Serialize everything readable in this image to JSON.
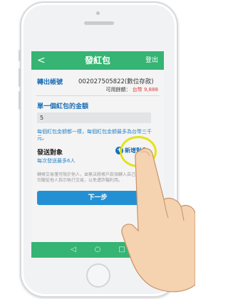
{
  "header": {
    "title": "發紅包",
    "back_icon": "back-arrow-icon",
    "logout_label": "登出"
  },
  "account": {
    "label": "轉出帳號",
    "number": "002027505822(數位存款)",
    "balance_label": "可用餘額：",
    "balance_value": "台幣 9,888"
  },
  "amount": {
    "label": "單一個紅包的金額",
    "value": "5",
    "hint": "每個紅包金額都一樣，每個紅包金額最多為台幣三千元。"
  },
  "recipients": {
    "title": "發送對象",
    "note": "每次發送最多6人",
    "add_label": "新增對象"
  },
  "fine_print": "轉帳交易僅可限於他人，並無法將帳戶款項轉入自己的帳戶，請勿聽從他人指示執行交易，以免遭詐騙利用。",
  "actions": {
    "next_label": "下一步"
  },
  "navbar": {
    "back": "◁",
    "home": "○",
    "recent": "□"
  },
  "colors": {
    "brand_green": "#35b473",
    "link_blue": "#1d6fb5",
    "button_blue": "#2490d4",
    "balance_red": "#e53935",
    "highlight_yellow": "#e3e31a"
  }
}
